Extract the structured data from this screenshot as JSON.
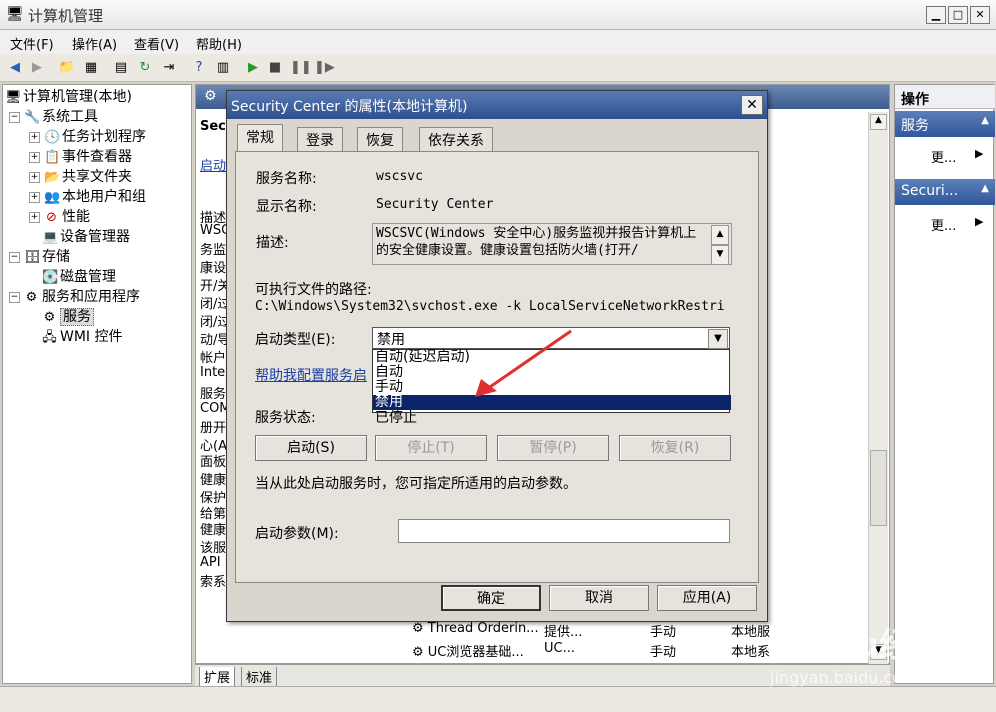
{
  "window": {
    "title": "计算机管理"
  },
  "menu": [
    "文件(F)",
    "操作(A)",
    "查看(V)",
    "帮助(H)"
  ],
  "tree": {
    "root": "计算机管理(本地)",
    "system_tools": "系统工具",
    "task_scheduler": "任务计划程序",
    "event_viewer": "事件查看器",
    "shared_folders": "共享文件夹",
    "local_users": "本地用户和组",
    "performance": "性能",
    "device_manager": "设备管理器",
    "storage": "存储",
    "disk_mgmt": "磁盘管理",
    "services_apps": "服务和应用程序",
    "services": "服务",
    "wmi": "WMI 控件"
  },
  "center": {
    "left_fragments": [
      "Sec",
      "启动",
      "描述",
      "WSC",
      "务监",
      "康设",
      "开/关",
      "闭/过",
      "闭/过",
      "动/导",
      "帐户",
      "Inte",
      "服务",
      "COM",
      "册开",
      "心(A",
      "面板",
      "健康",
      "保护",
      "给第",
      "健康",
      "该服",
      "API",
      "索系"
    ],
    "right_rows": [
      {
        "name": "Thread Orderin...",
        "desc": "提供...",
        "startup": "手动",
        "logon": "本地服"
      },
      {
        "name": "UC浏览器基础...",
        "desc": "UC...",
        "startup": "手动",
        "logon": "本地系"
      }
    ],
    "bottom_tabs": [
      "扩展",
      "标准"
    ]
  },
  "actions": {
    "header": "操作",
    "section1": "服务",
    "more1": "更...",
    "section2": "Securi...",
    "more2": "更..."
  },
  "dialog": {
    "title": "Security Center 的属性(本地计算机)",
    "tabs": [
      "常规",
      "登录",
      "恢复",
      "依存关系"
    ],
    "service_name_label": "服务名称:",
    "service_name": "wscsvc",
    "display_name_label": "显示名称:",
    "display_name": "Security Center",
    "desc_label": "描述:",
    "desc_text": "WSCSVC(Windows 安全中心)服务监视并报告计算机上的安全健康设置。健康设置包括防火墙(打开/",
    "exe_path_label": "可执行文件的路径:",
    "exe_path": "C:\\Windows\\System32\\svchost.exe -k LocalServiceNetworkRestri",
    "startup_type_label": "启动类型(E):",
    "startup_type_value": "禁用",
    "startup_options": [
      "自动(延迟启动)",
      "自动",
      "手动",
      "禁用"
    ],
    "help_link": "帮助我配置服务启",
    "service_status_label": "服务状态:",
    "service_status": "已停止",
    "buttons": {
      "start": "启动(S)",
      "stop": "停止(T)",
      "pause": "暂停(P)",
      "resume": "恢复(R)"
    },
    "hint": "当从此处启动服务时，您可指定所适用的启动参数。",
    "start_params_label": "启动参数(M):",
    "ok": "确定",
    "cancel": "取消",
    "apply": "应用(A)"
  },
  "watermark": {
    "main": "Baidu经验",
    "sub": "jingyan.baidu.com"
  }
}
